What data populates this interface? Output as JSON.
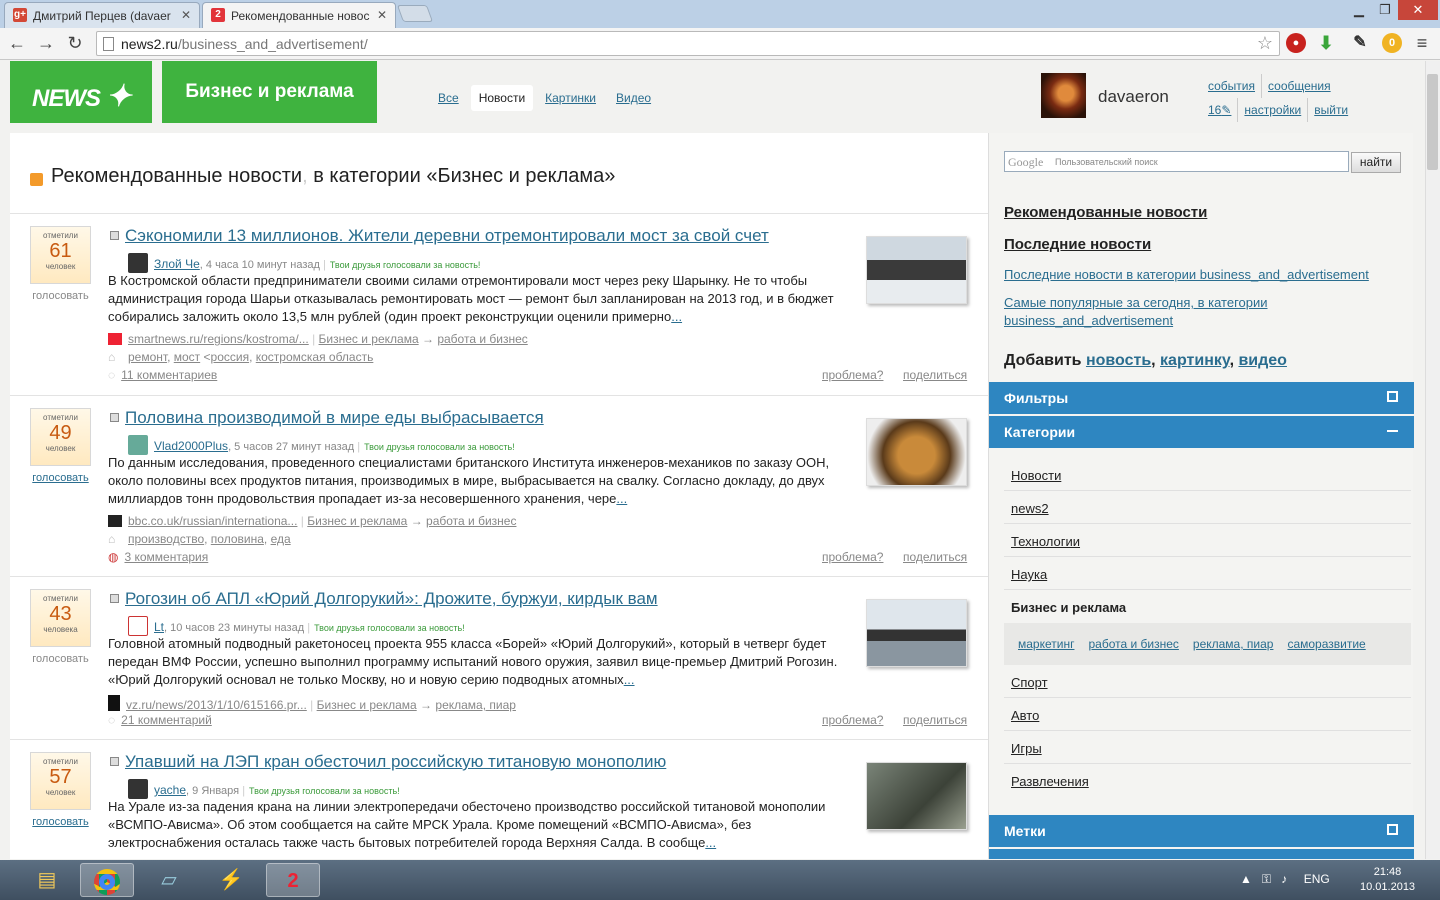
{
  "browser": {
    "tabs": [
      {
        "title": "Дмитрий Перцев (davaer"
      },
      {
        "title": "Рекомендованные новос"
      }
    ],
    "url_host": "news2.ru",
    "url_path": "/business_and_advertisement/",
    "ext_badge": "0"
  },
  "header": {
    "logo_text": "NEWS",
    "category_title": "Бизнес и реклама",
    "nav": [
      "Все",
      "Новости",
      "Картинки",
      "Видео"
    ],
    "username": "davaeron",
    "user_menu": {
      "events": "события",
      "messages": "сообщения",
      "karma": "16",
      "settings": "настройки",
      "logout": "выйти"
    }
  },
  "feed": {
    "heading_main": "Рекомендованные новости",
    "heading_sep": ",",
    "heading_cat": " в категории «Бизнес и реклама»",
    "items": [
      {
        "votes": "61",
        "voted_label": "отметили",
        "people": "человек",
        "vote_action": "голосовать",
        "title": "Сэкономили 13 миллионов. Жители деревни отремонтировали мост за свой счет",
        "author": "Злой Че",
        "time": ", 4 часа 10 минут назад",
        "friends": "Твои друзья голосовали за новость!",
        "text": "В Костромской области предприниматели своими силами отремонтировали мост через реку Шарынку. Не то чтобы администрация города Шарьи отказывалась ремонтировать мост — ремонт был запланирован на 2013 год, и в бюджет собирались заложить около 13,5 млн рублей (один проект реконструкции оценили примерно",
        "source": "smartnews.ru/regions/kostroma/...",
        "cat": "Бизнес и реклама",
        "subcat": "работа и бизнес",
        "tags_a": "ремонт",
        "tags_b": "мост",
        "tags_c": "россия",
        "tags_d": "костромская область",
        "comments": "11 комментариев"
      },
      {
        "votes": "49",
        "voted_label": "отметили",
        "people": "человек",
        "vote_action": "голосовать",
        "title": "Половина производимой в мире еды выбрасывается",
        "author": "Vlad2000Plus",
        "time": ", 5 часов 27 минут назад",
        "friends": "Твои друзья голосовали за новость!",
        "text": "По данным исследования, проведенного специалистами британского Института инженеров-механиков по заказу ООН, около половины всех продуктов питания, производимых в мире, выбрасывается на свалку. Согласно докладу, до двух миллиардов тонн продовольствия пропадает из-за несовершенного хранения, чере",
        "source": "bbc.co.uk/russian/internationa...",
        "cat": "Бизнес и реклама",
        "subcat": "работа и бизнес",
        "tags_a": "производство",
        "tags_b": "половина",
        "tags_c": "еда",
        "comments": "3 комментария"
      },
      {
        "votes": "43",
        "voted_label": "отметили",
        "people": "человека",
        "vote_action": "голосовать",
        "title": "Рогозин об АПЛ «Юрий Долгорукий»: Дрожите, буржуи, кирдык вам",
        "author": "Lt",
        "time": ", 10 часов 23 минуты назад",
        "friends": "Твои друзья голосовали за новость!",
        "text": "Головной атомный подводный ракетоносец проекта 955 класса «Борей» «Юрий Долгорукий», который в четверг будет передан ВМФ России, успешно выполнил программу испытаний нового оружия, заявил вице-премьер Дмитрий Рогозин. «Юрий Долгорукий основал не только Москву, но и новую серию подводных атомных",
        "source": "vz.ru/news/2013/1/10/615166.pr...",
        "cat": "Бизнес и реклама",
        "subcat": "реклама, пиар",
        "comments": "21 комментарий"
      },
      {
        "votes": "57",
        "voted_label": "отметили",
        "people": "человек",
        "vote_action": "голосовать",
        "title": "Упавший на ЛЭП кран обесточил российскую титановую монополию",
        "author": "yache",
        "time": ", 9 Января",
        "friends": "Твои друзья голосовали за новость!",
        "text": "На Урале из-за падения крана на линии электропередачи обесточено производство российской титановой монополии «ВСМПО-Ависма». Об этом сообщается на сайте МРСК Урала. Кроме помещений «ВСМПО-Ависма», без электроснабжения осталась также часть бытовых потребителей города Верхняя Салда. В сообще"
      }
    ],
    "more": "...",
    "problem": "проблема?",
    "share": "поделиться",
    "arrow": "→"
  },
  "sidebar": {
    "search_placeholder": "Пользовательский поиск",
    "google": "Google",
    "search_button": "найти",
    "links": {
      "recommended": "Рекомендованные новости",
      "latest": "Последние новости",
      "latest_cat": "Последние новости в категории business_and_advertisement",
      "popular_cat": "Самые популярные за сегодня, в категории business_and_advertisement"
    },
    "add_prefix": "Добавить",
    "add_news": "новость",
    "add_picture": "картинку",
    "add_video": "видео",
    "filters": "Фильтры",
    "categories": "Категории",
    "tags": "Метки",
    "category_items": [
      "Новости",
      "news2",
      "Технологии",
      "Наука",
      "Бизнес и реклама"
    ],
    "subcategories": [
      "маркетинг",
      "работа и бизнес",
      "реклама, пиар",
      "саморазвитие"
    ],
    "category_items_after": [
      "Спорт",
      "Авто",
      "Игры",
      "Развлечения"
    ]
  },
  "taskbar": {
    "lang": "ENG",
    "time": "21:48",
    "date": "10.01.2013"
  },
  "colors": {
    "accent": "#3fb33f",
    "panel": "#2e86c1",
    "link": "#2a6d8f"
  }
}
